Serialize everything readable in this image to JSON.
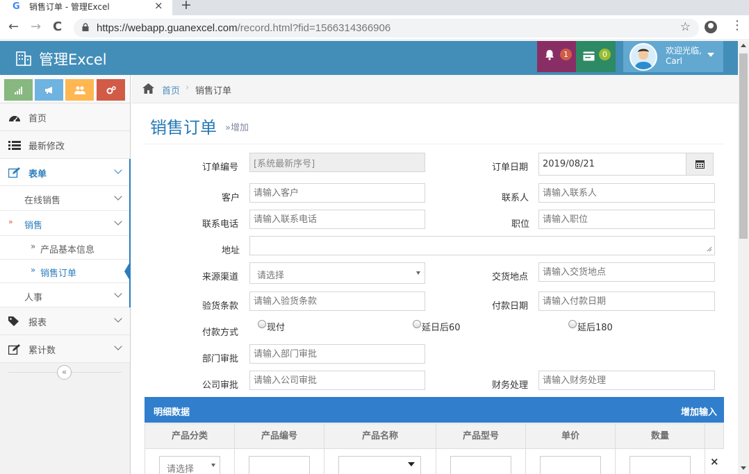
{
  "browser": {
    "tab_title": "销售订单 - 管理Excel",
    "favicon": "G",
    "close": "×",
    "new_tab": "+",
    "url_main": "https://webapp.guanexcel.com",
    "url_path": "/record.html?fid=1566314366906",
    "back": "←",
    "forward": "→",
    "reload": "C",
    "star": "☆",
    "menu": "⋮"
  },
  "header": {
    "brand": "管理Excel",
    "bell_count": "1",
    "bell_color": "#892e65",
    "msg_count": "0",
    "msg_color": "#2e8965",
    "welcome": "欢迎光临,",
    "user": "Carl"
  },
  "sidebar": {
    "shortcut_colors": [
      "#87b87f",
      "#6fb3e0",
      "#ffb752",
      "#d15b47"
    ],
    "items": [
      {
        "label": "首页",
        "icon": "dashboard-icon"
      },
      {
        "label": "最新修改",
        "icon": "list-icon"
      },
      {
        "label": "表单",
        "icon": "edit-icon"
      },
      {
        "label": "报表",
        "icon": "tag-icon"
      },
      {
        "label": "累计数",
        "icon": "edit-icon"
      }
    ],
    "sub": {
      "online": "在线销售",
      "sales": "销售",
      "product_info": "产品基本信息",
      "sales_order": "销售订单",
      "hr": "人事"
    },
    "collapse": "«"
  },
  "breadcrumb": {
    "home": "首页",
    "sep": "›",
    "current": "销售订单"
  },
  "page": {
    "title": "销售订单",
    "subtitle": "»增加"
  },
  "form": {
    "order_no_label": "订单编号",
    "order_no_value": "[系统最新序号]",
    "order_date_label": "订单日期",
    "order_date_value": "2019/08/21",
    "customer_label": "客户",
    "customer_ph": "请输入客户",
    "contact_label": "联系人",
    "contact_ph": "请输入联系人",
    "phone_label": "联系电话",
    "phone_ph": "请输入联系电话",
    "position_label": "职位",
    "position_ph": "请输入职位",
    "address_label": "地址",
    "source_label": "来源渠道",
    "source_value": "请选择",
    "delivery_label": "交货地点",
    "delivery_ph": "请输入交货地点",
    "inspection_label": "验货条款",
    "inspection_ph": "请输入验货条款",
    "paydate_label": "付款日期",
    "paydate_ph": "请输入付款日期",
    "paymethod_label": "付款方式",
    "pay_options": [
      "现付",
      "延日后60",
      "延后180"
    ],
    "dept_label": "部门审批",
    "dept_ph": "请输入部门审批",
    "company_label": "公司审批",
    "company_ph": "请输入公司审批",
    "finance_label": "财务处理",
    "finance_ph": "请输入财务处理"
  },
  "detail": {
    "title": "明细数据",
    "add": "增加输入",
    "columns": [
      "产品分类",
      "产品编号",
      "产品名称",
      "产品型号",
      "单价",
      "数量"
    ],
    "row_select": "请选择",
    "delete": "×"
  }
}
